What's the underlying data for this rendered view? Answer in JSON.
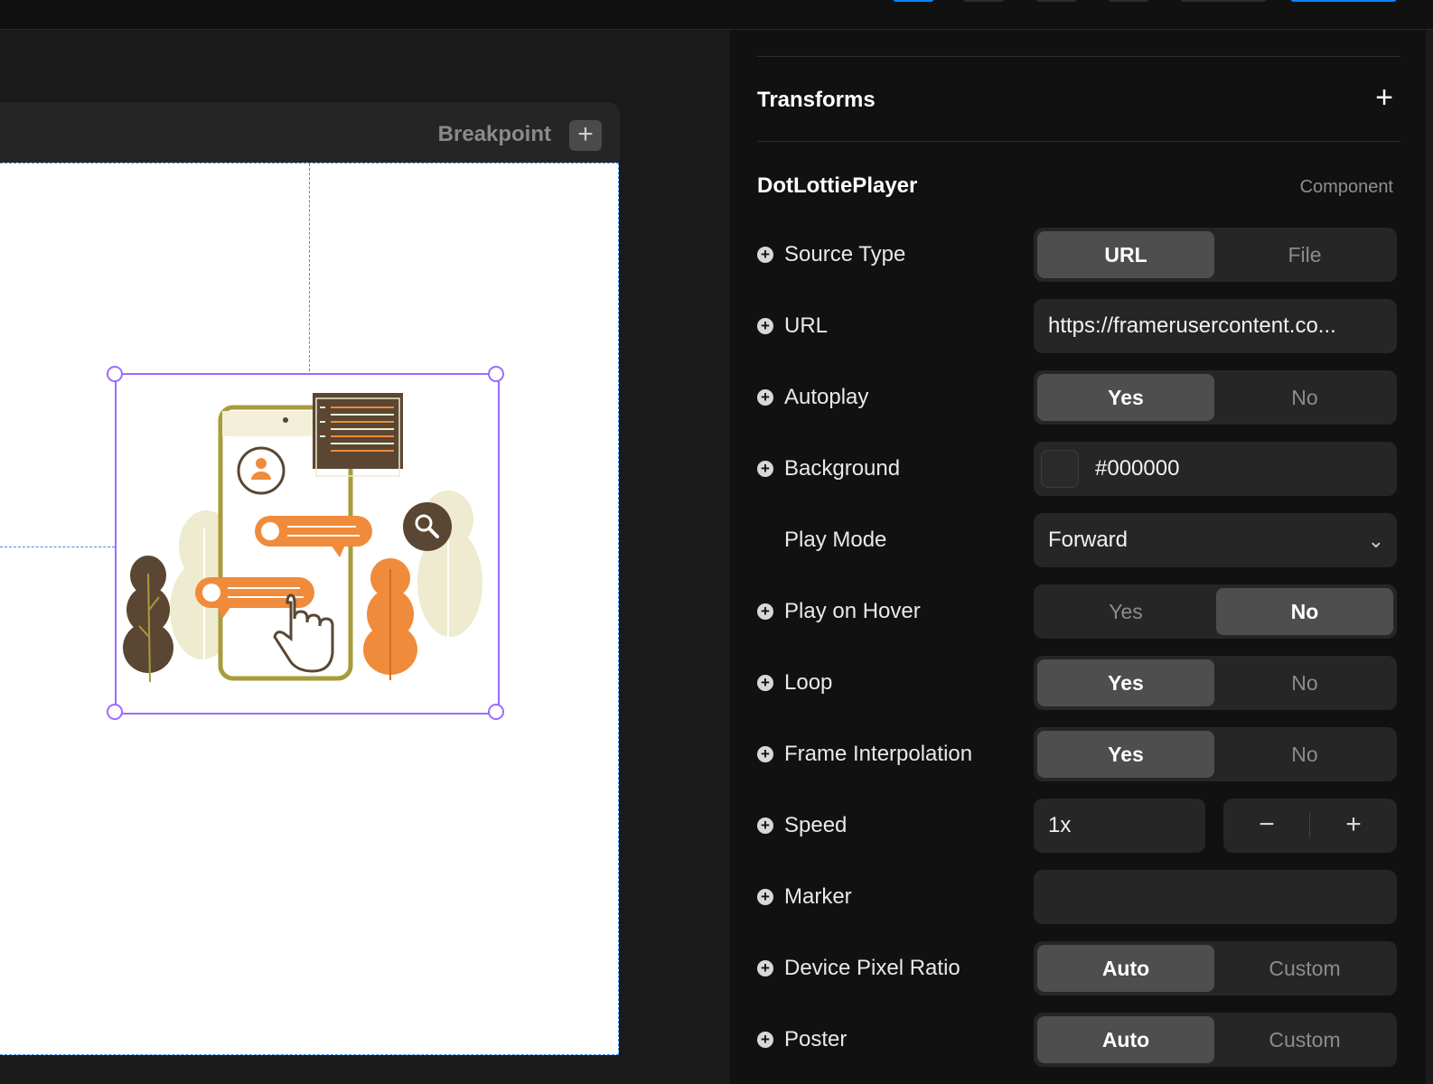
{
  "canvas": {
    "breakpoint_label": "Breakpoint",
    "breakpoint_add": "+"
  },
  "panel": {
    "transforms": {
      "title": "Transforms",
      "add": "+"
    },
    "component": {
      "title": "DotLottiePlayer",
      "subtitle": "Component"
    },
    "add_icon": "+",
    "rows": {
      "source_type": {
        "label": "Source Type",
        "options": [
          "URL",
          "File"
        ],
        "selected": "URL"
      },
      "url": {
        "label": "URL",
        "value": "https://framerusercontent.co..."
      },
      "autoplay": {
        "label": "Autoplay",
        "options": [
          "Yes",
          "No"
        ],
        "selected": "Yes"
      },
      "background": {
        "label": "Background",
        "value": "#000000"
      },
      "play_mode": {
        "label": "Play Mode",
        "value": "Forward"
      },
      "play_on_hover": {
        "label": "Play on Hover",
        "options": [
          "Yes",
          "No"
        ],
        "selected": "No"
      },
      "loop": {
        "label": "Loop",
        "options": [
          "Yes",
          "No"
        ],
        "selected": "Yes"
      },
      "frame_interpolation": {
        "label": "Frame Interpolation",
        "options": [
          "Yes",
          "No"
        ],
        "selected": "Yes"
      },
      "speed": {
        "label": "Speed",
        "value": "1x",
        "minus": "−",
        "plus": "+"
      },
      "marker": {
        "label": "Marker",
        "value": ""
      },
      "device_pixel_ratio": {
        "label": "Device Pixel Ratio",
        "options": [
          "Auto",
          "Custom"
        ],
        "selected": "Auto"
      },
      "poster": {
        "label": "Poster",
        "options": [
          "Auto",
          "Custom"
        ],
        "selected": "Auto"
      }
    }
  }
}
